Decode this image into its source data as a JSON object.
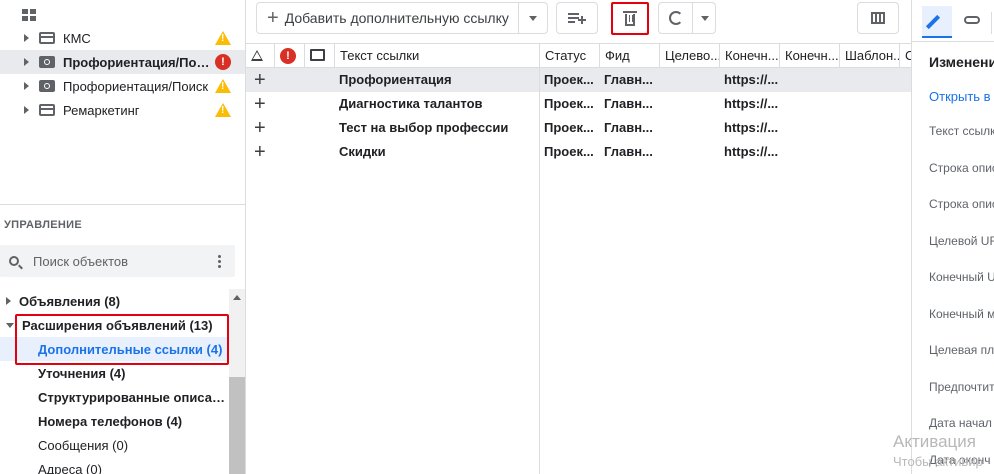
{
  "tree": {
    "campaigns": [
      {
        "name": "КМС",
        "type": "kms",
        "status": "warning",
        "selected": false
      },
      {
        "name": "Профориентация/Поиск...",
        "type": "search",
        "status": "error",
        "selected": true
      },
      {
        "name": "Профориентация/Поиск",
        "type": "search",
        "status": "warning",
        "selected": false
      },
      {
        "name": "Ремаркетинг",
        "type": "kms",
        "status": "warning",
        "selected": false
      }
    ]
  },
  "manage": {
    "header": "УПРАВЛЕНИЕ",
    "search_placeholder": "Поиск объектов",
    "items": [
      {
        "label": "Объявления (8)",
        "expand": "right",
        "indent": 0,
        "bold": true,
        "selected": false
      },
      {
        "label": "Расширения объявлений (13)",
        "expand": "down",
        "indent": 0,
        "bold": true,
        "selected": false
      },
      {
        "label": "Дополнительные ссылки (4)",
        "expand": "none",
        "indent": 1,
        "bold": true,
        "selected": true
      },
      {
        "label": "Уточнения (4)",
        "expand": "none",
        "indent": 1,
        "bold": true,
        "selected": false
      },
      {
        "label": "Структурированные описани...",
        "expand": "none",
        "indent": 1,
        "bold": true,
        "selected": false
      },
      {
        "label": "Номера телефонов (4)",
        "expand": "none",
        "indent": 1,
        "bold": true,
        "selected": false
      },
      {
        "label": "Сообщения (0)",
        "expand": "none",
        "indent": 1,
        "bold": false,
        "selected": false
      },
      {
        "label": "Адреса (0)",
        "expand": "none",
        "indent": 1,
        "bold": false,
        "selected": false
      }
    ]
  },
  "toolbar": {
    "add_label": "Добавить дополнительную ссылку"
  },
  "grid": {
    "columns": [
      "Текст ссылки",
      "Статус",
      "Фид",
      "Целево...",
      "Конечн...",
      "Конечн...",
      "Шаблон...",
      "С"
    ],
    "rows": [
      {
        "text": "Профориентация",
        "status": "Проек...",
        "feed": "Главн...",
        "target": "",
        "final_url": "https://...",
        "final_mobile": "",
        "template": "",
        "selected": true
      },
      {
        "text": "Диагностика талантов",
        "status": "Проек...",
        "feed": "Главн...",
        "target": "",
        "final_url": "https://...",
        "final_mobile": "",
        "template": "",
        "selected": false
      },
      {
        "text": "Тест на выбор профессии",
        "status": "Проек...",
        "feed": "Главн...",
        "target": "",
        "final_url": "https://...",
        "final_mobile": "",
        "template": "",
        "selected": false
      },
      {
        "text": "Скидки",
        "status": "Проек...",
        "feed": "Главн...",
        "target": "",
        "final_url": "https://...",
        "final_mobile": "",
        "template": "",
        "selected": false
      }
    ]
  },
  "right_panel": {
    "title": "Изменени",
    "open_link": "Открыть в",
    "fields": [
      "Текст ссылк",
      "Строка опис",
      "Строка опис",
      "Целевой UR",
      "Конечный U",
      "Конечный м",
      "Целевая пла",
      "Предпочтит",
      "Дата начал",
      "Дата оконч"
    ]
  },
  "watermark": {
    "line1": "Активация",
    "line2": "Чтобы активир"
  },
  "colors": {
    "accent": "#1a73e8",
    "highlight_box": "#e3000f",
    "warning": "#fbbc04",
    "error": "#d93025"
  }
}
